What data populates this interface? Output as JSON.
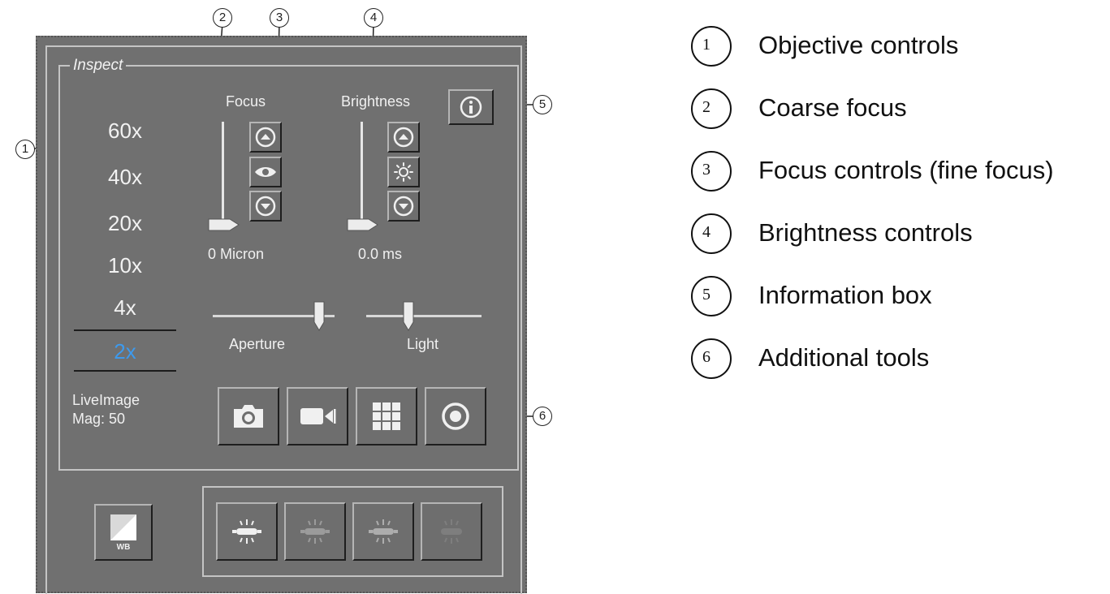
{
  "panel": {
    "title": "Inspect",
    "magnifications": [
      "60x",
      "40x",
      "20x",
      "10x",
      "4x",
      "2x"
    ],
    "selected_magnification": "2x",
    "live_image_label": "LiveImage",
    "mag_readout": "Mag: 50",
    "focus": {
      "label": "Focus",
      "value": "0 Micron",
      "up_icon": "arrow-up-icon",
      "middle_icon": "eye-icon",
      "down_icon": "arrow-down-icon"
    },
    "brightness": {
      "label": "Brightness",
      "value": "0.0 ms",
      "up_icon": "arrow-up-icon",
      "middle_icon": "sun-icon",
      "down_icon": "arrow-down-icon"
    },
    "aperture": {
      "label": "Aperture",
      "level": 0.9
    },
    "light": {
      "label": "Light",
      "level": 0.38
    },
    "info_icon": "info-icon",
    "tools": [
      "camera-icon",
      "video-camera-icon",
      "grid-icon",
      "record-icon"
    ],
    "wb_button_label": "WB",
    "lamp_buttons": [
      "lamp-icon",
      "lamp-icon",
      "lamp-icon",
      "lamp-icon"
    ]
  },
  "callouts": [
    "1",
    "2",
    "3",
    "4",
    "5",
    "6"
  ],
  "legend": [
    {
      "num": "1",
      "text": "Objective controls"
    },
    {
      "num": "2",
      "text": "Coarse focus"
    },
    {
      "num": "3",
      "text": "Focus controls (fine focus)"
    },
    {
      "num": "4",
      "text": "Brightness controls"
    },
    {
      "num": "5",
      "text": "Information box"
    },
    {
      "num": "6",
      "text": "Additional tools"
    }
  ]
}
